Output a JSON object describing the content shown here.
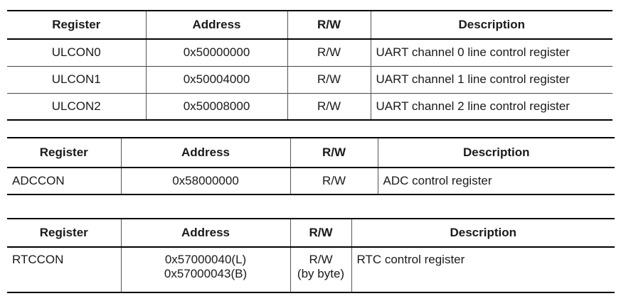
{
  "table1": {
    "headers": [
      "Register",
      "Address",
      "R/W",
      "Description"
    ],
    "rows": [
      [
        "ULCON0",
        "0x50000000",
        "R/W",
        "UART channel 0 line control register"
      ],
      [
        "ULCON1",
        "0x50004000",
        "R/W",
        "UART channel 1 line control register"
      ],
      [
        "ULCON2",
        "0x50008000",
        "R/W",
        "UART channel 2 line control register"
      ]
    ]
  },
  "table2": {
    "headers": [
      "Register",
      "Address",
      "R/W",
      "Description"
    ],
    "rows": [
      [
        "ADCCON",
        "0x58000000",
        "R/W",
        "ADC control register"
      ]
    ]
  },
  "table3": {
    "headers": [
      "Register",
      "Address",
      "R/W",
      "Description"
    ],
    "row": {
      "register": "RTCCON",
      "address_lines": [
        "0x57000040(L)",
        "0x57000043(B)"
      ],
      "rw_lines": [
        "R/W",
        "(by byte)"
      ],
      "description": "RTC control register"
    }
  }
}
